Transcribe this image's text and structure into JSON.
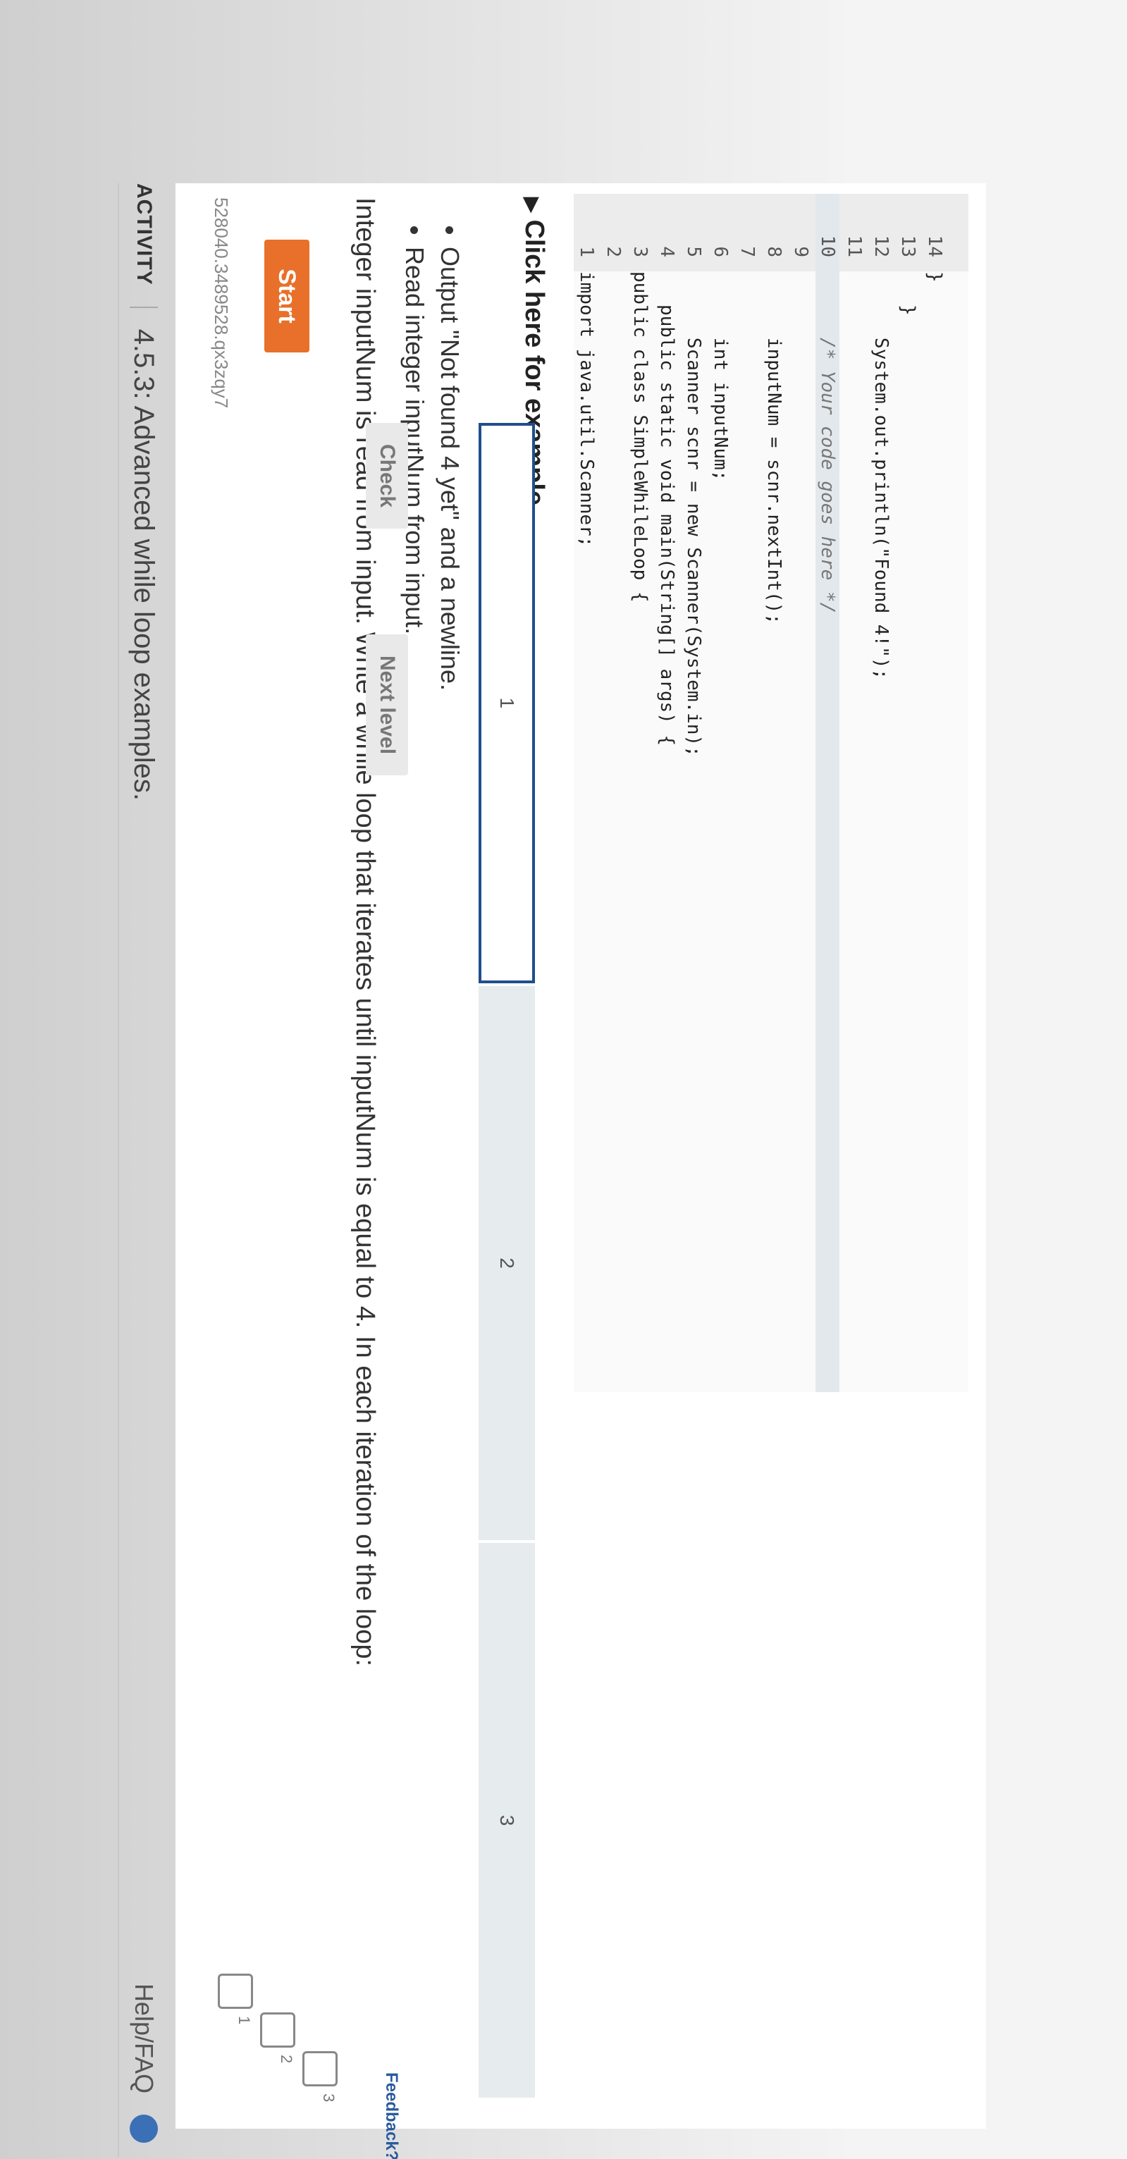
{
  "header": {
    "activity_label": "ACTIVITY",
    "title": "4.5.3: Advanced while loop examples.",
    "help_text": "Help/FAQ"
  },
  "activity_id": "528040.3489528.qx3zqy7",
  "start_label": "Start",
  "prompt": "Integer inputNum is read from input. Write a while loop that iterates until inputNum is equal to 4. In each iteration of the loop:",
  "bullets": [
    "Output \"Not found 4 yet\" and a newline.",
    "Read integer inputNum from input."
  ],
  "example_label": "Click here for example",
  "code": [
    {
      "n": "1",
      "text": "import java.util.Scanner;"
    },
    {
      "n": "2",
      "text": ""
    },
    {
      "n": "3",
      "text": "public class SimpleWhileLoop {"
    },
    {
      "n": "4",
      "text": "   public static void main(String[] args) {"
    },
    {
      "n": "5",
      "text": "      Scanner scnr = new Scanner(System.in);"
    },
    {
      "n": "6",
      "text": "      int inputNum;"
    },
    {
      "n": "7",
      "text": ""
    },
    {
      "n": "8",
      "text": "      inputNum = scnr.nextInt();"
    },
    {
      "n": "9",
      "text": ""
    },
    {
      "n": "10",
      "text": "      /* Your code goes here */"
    },
    {
      "n": "11",
      "text": ""
    },
    {
      "n": "12",
      "text": "      System.out.println(\"Found 4!\");"
    },
    {
      "n": "13",
      "text": "   }"
    },
    {
      "n": "14",
      "text": "}"
    }
  ],
  "levels": [
    "1",
    "2",
    "3"
  ],
  "progress_segments": [
    "1",
    "2",
    "3"
  ],
  "active_segment": 1,
  "check_label": "Check",
  "next_label": "Next level",
  "feedback_label": "Feedback?"
}
